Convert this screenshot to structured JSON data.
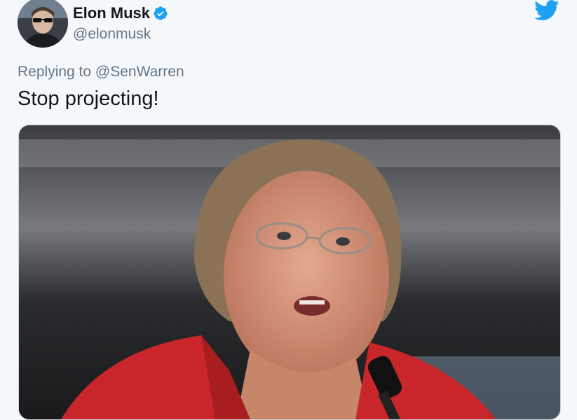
{
  "author": {
    "name": "Elon Musk",
    "handle": "@elonmusk",
    "verified": true,
    "avatar_icon": "profile-photo"
  },
  "reply": {
    "prefix": "Replying to",
    "user": "@SenWarren"
  },
  "tweet": {
    "text": "Stop projecting!"
  },
  "media": {
    "description_icon": "photo-of-woman-speaking-at-microphone"
  },
  "brand": {
    "logo_icon": "twitter-bird-icon",
    "accent": "#1da1f2",
    "verified_color": "#1da1f2",
    "secondary_text": "#657786",
    "primary_text": "#14171a",
    "background": "#f5f8fa"
  }
}
